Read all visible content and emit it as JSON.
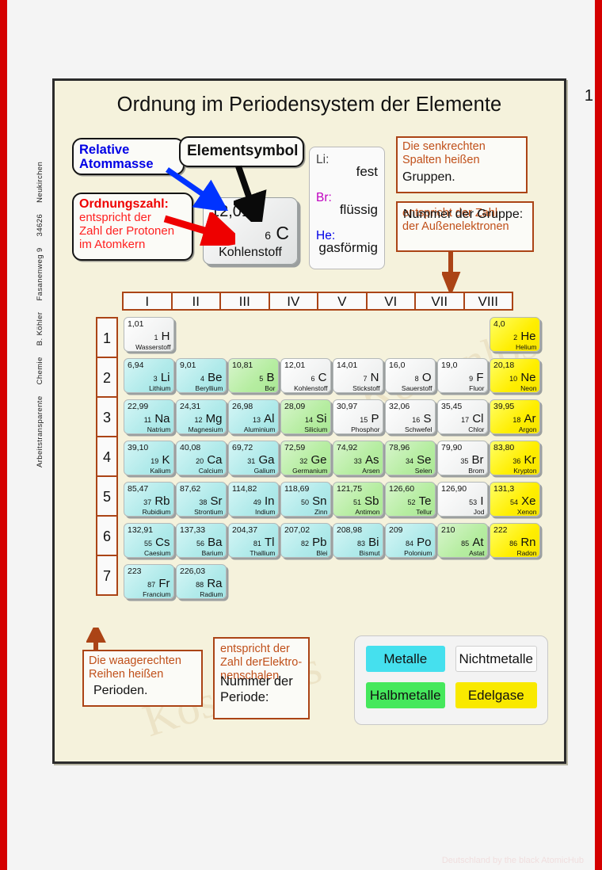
{
  "page": {
    "number": "1",
    "title": "Ordnung im Periodensystem der Elemente",
    "credit": [
      "Arbeitstransparente",
      "Chemie",
      "B. Köhler",
      "Fasanenweg 9",
      "34626",
      "Neukirchen"
    ],
    "footer_watermark": "Deutschland by the black AtomicHub",
    "watermark": "Kostenlos"
  },
  "callouts": {
    "atommasse": {
      "line1": "Relative",
      "line2": "Atommasse"
    },
    "elementsymbol": {
      "label": "Elementsymbol"
    },
    "ordnungszahl": {
      "head": "Ordnungszahl:",
      "body_line1": "entspricht der",
      "body_line2": "Zahl der Protonen",
      "body_line3": "im Atomkern"
    },
    "gruppen": {
      "orange_line1": "Die senkrechten",
      "orange_line2": "Spalten heißen",
      "black_line": "Gruppen."
    },
    "gruppenzahl": {
      "black_line": "Nummer der Gruppe:",
      "orange_line1": "entspricht der Zahl",
      "orange_line2": "der Außenelektronen"
    },
    "perioden": {
      "orange_line1": "Die waagerechten",
      "orange_line2": "Reihen heißen",
      "black_line": "Perioden."
    },
    "periodenzahl": {
      "orange_line1": "entspricht der",
      "orange_line2": "Zahl derElektro-",
      "orange_line3": "nenschalen",
      "black_line1": "Nummer der",
      "black_line2": "Periode:"
    }
  },
  "sample_card": {
    "mass": "12,01",
    "number": "6",
    "symbol": "C",
    "name": "Kohlenstoff"
  },
  "states": [
    {
      "symbol": "Li:",
      "state": "fest"
    },
    {
      "symbol": "Br:",
      "state": "flüssig"
    },
    {
      "symbol": "He:",
      "state": "gasförmig"
    }
  ],
  "table": {
    "groups": [
      "I",
      "II",
      "III",
      "IV",
      "V",
      "VI",
      "VII",
      "VIII"
    ],
    "periods": [
      "1",
      "2",
      "3",
      "4",
      "5",
      "6",
      "7"
    ],
    "rows": [
      [
        {
          "mass": "1,01",
          "num": "1",
          "sym": "H",
          "name": "Wasserstoff",
          "cat": "nonmetal"
        },
        null,
        null,
        null,
        null,
        null,
        null,
        {
          "mass": "4,0",
          "num": "2",
          "sym": "He",
          "name": "Helium",
          "cat": "noble"
        }
      ],
      [
        {
          "mass": "6,94",
          "num": "3",
          "sym": "Li",
          "name": "Lithium",
          "cat": "metal"
        },
        {
          "mass": "9,01",
          "num": "4",
          "sym": "Be",
          "name": "Beryllium",
          "cat": "metal"
        },
        {
          "mass": "10,81",
          "num": "5",
          "sym": "B",
          "name": "Bor",
          "cat": "semimetal"
        },
        {
          "mass": "12,01",
          "num": "6",
          "sym": "C",
          "name": "Kohlenstoff",
          "cat": "nonmetal"
        },
        {
          "mass": "14,01",
          "num": "7",
          "sym": "N",
          "name": "Stickstoff",
          "cat": "nonmetal"
        },
        {
          "mass": "16,0",
          "num": "8",
          "sym": "O",
          "name": "Sauerstoff",
          "cat": "nonmetal"
        },
        {
          "mass": "19,0",
          "num": "9",
          "sym": "F",
          "name": "Fluor",
          "cat": "nonmetal"
        },
        {
          "mass": "20,18",
          "num": "10",
          "sym": "Ne",
          "name": "Neon",
          "cat": "noble"
        }
      ],
      [
        {
          "mass": "22,99",
          "num": "11",
          "sym": "Na",
          "name": "Natrium",
          "cat": "metal"
        },
        {
          "mass": "24,31",
          "num": "12",
          "sym": "Mg",
          "name": "Magnesium",
          "cat": "metal"
        },
        {
          "mass": "26,98",
          "num": "13",
          "sym": "Al",
          "name": "Aluminium",
          "cat": "metal"
        },
        {
          "mass": "28,09",
          "num": "14",
          "sym": "Si",
          "name": "Silicium",
          "cat": "semimetal"
        },
        {
          "mass": "30,97",
          "num": "15",
          "sym": "P",
          "name": "Phosphor",
          "cat": "nonmetal"
        },
        {
          "mass": "32,06",
          "num": "16",
          "sym": "S",
          "name": "Schwefel",
          "cat": "nonmetal"
        },
        {
          "mass": "35,45",
          "num": "17",
          "sym": "Cl",
          "name": "Chlor",
          "cat": "nonmetal"
        },
        {
          "mass": "39,95",
          "num": "18",
          "sym": "Ar",
          "name": "Argon",
          "cat": "noble"
        }
      ],
      [
        {
          "mass": "39,10",
          "num": "19",
          "sym": "K",
          "name": "Kalium",
          "cat": "metal"
        },
        {
          "mass": "40,08",
          "num": "20",
          "sym": "Ca",
          "name": "Calcium",
          "cat": "metal"
        },
        {
          "mass": "69,72",
          "num": "31",
          "sym": "Ga",
          "name": "Galium",
          "cat": "metal"
        },
        {
          "mass": "72,59",
          "num": "32",
          "sym": "Ge",
          "name": "Germanium",
          "cat": "semimetal"
        },
        {
          "mass": "74,92",
          "num": "33",
          "sym": "As",
          "name": "Arsen",
          "cat": "semimetal"
        },
        {
          "mass": "78,96",
          "num": "34",
          "sym": "Se",
          "name": "Selen",
          "cat": "semimetal"
        },
        {
          "mass": "79,90",
          "num": "35",
          "sym": "Br",
          "name": "Brom",
          "cat": "nonmetal"
        },
        {
          "mass": "83,80",
          "num": "36",
          "sym": "Kr",
          "name": "Krypton",
          "cat": "noble"
        }
      ],
      [
        {
          "mass": "85,47",
          "num": "37",
          "sym": "Rb",
          "name": "Rubidium",
          "cat": "metal"
        },
        {
          "mass": "87,62",
          "num": "38",
          "sym": "Sr",
          "name": "Strontium",
          "cat": "metal"
        },
        {
          "mass": "114,82",
          "num": "49",
          "sym": "In",
          "name": "Indium",
          "cat": "metal"
        },
        {
          "mass": "118,69",
          "num": "50",
          "sym": "Sn",
          "name": "Zinn",
          "cat": "metal"
        },
        {
          "mass": "121,75",
          "num": "51",
          "sym": "Sb",
          "name": "Antimon",
          "cat": "semimetal"
        },
        {
          "mass": "126,60",
          "num": "52",
          "sym": "Te",
          "name": "Tellur",
          "cat": "semimetal"
        },
        {
          "mass": "126,90",
          "num": "53",
          "sym": "I",
          "name": "Jod",
          "cat": "nonmetal"
        },
        {
          "mass": "131,3",
          "num": "54",
          "sym": "Xe",
          "name": "Xenon",
          "cat": "noble"
        }
      ],
      [
        {
          "mass": "132,91",
          "num": "55",
          "sym": "Cs",
          "name": "Caesium",
          "cat": "metal"
        },
        {
          "mass": "137,33",
          "num": "56",
          "sym": "Ba",
          "name": "Barium",
          "cat": "metal"
        },
        {
          "mass": "204,37",
          "num": "81",
          "sym": "Tl",
          "name": "Thallium",
          "cat": "metal"
        },
        {
          "mass": "207,02",
          "num": "82",
          "sym": "Pb",
          "name": "Blei",
          "cat": "metal"
        },
        {
          "mass": "208,98",
          "num": "83",
          "sym": "Bi",
          "name": "Bismut",
          "cat": "metal"
        },
        {
          "mass": "209",
          "num": "84",
          "sym": "Po",
          "name": "Polonium",
          "cat": "metal"
        },
        {
          "mass": "210",
          "num": "85",
          "sym": "At",
          "name": "Astat",
          "cat": "semimetal"
        },
        {
          "mass": "222",
          "num": "86",
          "sym": "Rn",
          "name": "Radon",
          "cat": "noble"
        }
      ],
      [
        {
          "mass": "223",
          "num": "87",
          "sym": "Fr",
          "name": "Francium",
          "cat": "metal"
        },
        {
          "mass": "226,03",
          "num": "88",
          "sym": "Ra",
          "name": "Radium",
          "cat": "metal"
        },
        null,
        null,
        null,
        null,
        null,
        null
      ]
    ]
  },
  "legend": {
    "metalle": "Metalle",
    "nichtmetalle": "Nichtmetalle",
    "halbmetalle": "Halbmetalle",
    "edelgase": "Edelgase"
  },
  "colors": {
    "metal": "#b0eaea",
    "nonmetal": "#f2f3f3",
    "semimetal": "#b6eda1",
    "noble": "#ffee00",
    "accent_orange": "#ab4416",
    "sheet_bg": "#f5f2dc",
    "page_border": "#d40000"
  }
}
